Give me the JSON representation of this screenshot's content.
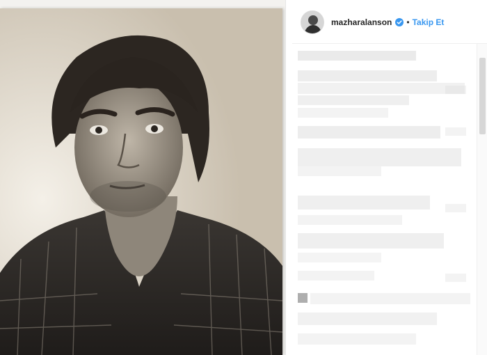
{
  "post": {
    "username": "mazharalanson",
    "verified": true,
    "separator": "•",
    "follow_label": "Takip Et"
  },
  "icons": {
    "verified": "verified-badge-icon",
    "avatar": "profile-avatar"
  },
  "colors": {
    "accent": "#3897f0",
    "text": "#262626",
    "blur": "#d8d8d8"
  }
}
